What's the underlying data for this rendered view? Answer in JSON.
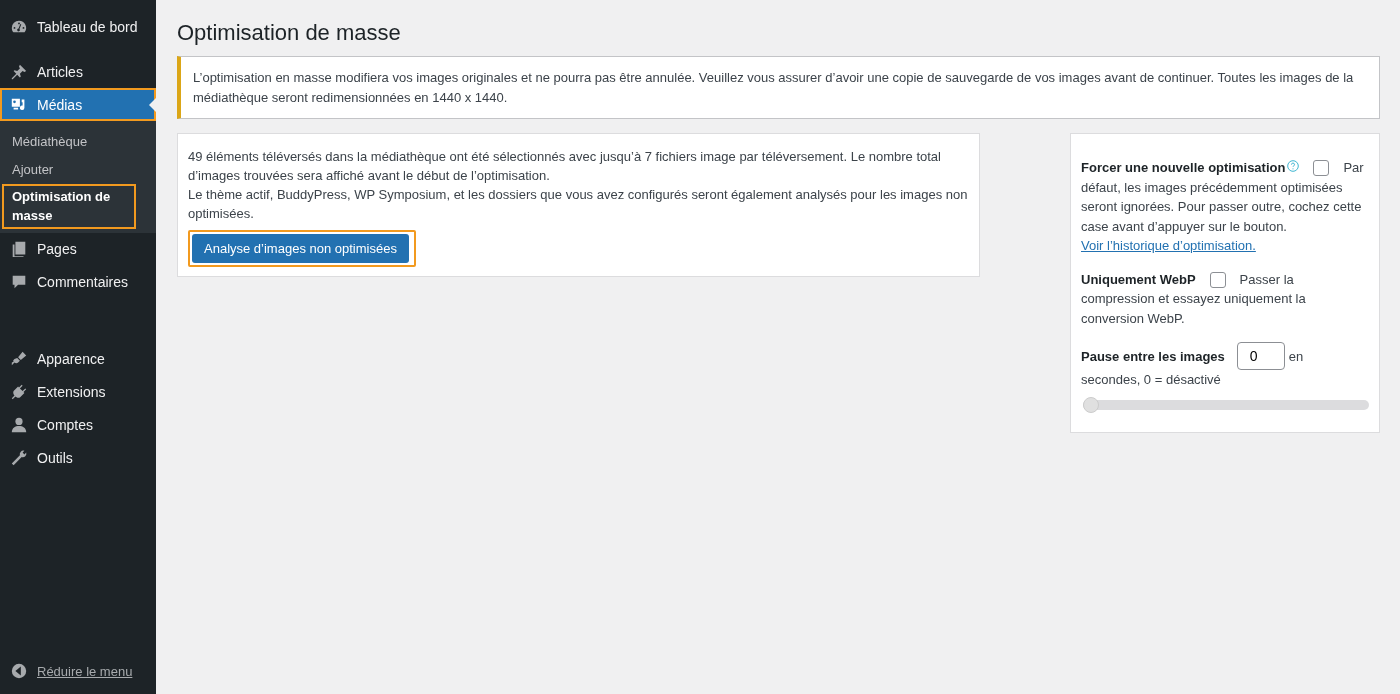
{
  "sidebar": {
    "groups": [
      [
        {
          "label": "Tableau de bord",
          "selected": false,
          "highlighted": false
        }
      ],
      [
        {
          "label": "Articles",
          "selected": false,
          "highlighted": false
        },
        {
          "label": "Médias",
          "selected": true,
          "highlighted": true,
          "children": [
            {
              "label": "Médiathèque",
              "selected": false,
              "highlighted": false
            },
            {
              "label": "Ajouter",
              "selected": false,
              "highlighted": false
            },
            {
              "label": "Optimisation de masse",
              "selected": true,
              "highlighted": true
            }
          ]
        },
        {
          "label": "Pages",
          "selected": false,
          "highlighted": false
        },
        {
          "label": "Commentaires",
          "selected": false,
          "highlighted": false
        }
      ],
      [
        {
          "label": "Apparence",
          "selected": false,
          "highlighted": false
        },
        {
          "label": "Extensions",
          "selected": false,
          "highlighted": false
        },
        {
          "label": "Comptes",
          "selected": false,
          "highlighted": false
        },
        {
          "label": "Outils",
          "selected": false,
          "highlighted": false
        }
      ]
    ],
    "collapse": "Réduire le menu"
  },
  "page_title": "Optimisation de masse",
  "notice": "L’optimisation en masse modifiera vos images originales et ne pourra pas être annulée. Veuillez vous assurer d’avoir une copie de sauvegarde de vos images avant de continuer. Toutes les images de la médiathèque seront redimensionnées en 1440 x 1440.",
  "scan_card": {
    "paragraphs": [
      "49 éléments téléversés dans la médiathèque ont été sélectionnés avec jusqu’à 7 fichiers image par téléversement. Le nombre total d’images trouvées sera affiché avant le début de l’optimisation.",
      "Le thème actif, BuddyPress, WP Symposium, et les dossiers que vous avez configurés seront également analysés pour les images non optimisées."
    ],
    "button": {
      "label": "Analyse d’images non optimisées",
      "highlighted": true
    }
  },
  "options": {
    "force": {
      "label": "Forcer une nouvelle optimisation",
      "checked": false,
      "description": [
        "Par",
        "défaut, les images précédemment optimisées seront ignorées. Pour passer outre, cochez cette case avant d’appuyer sur le bouton."
      ],
      "link": "Voir l’historique d’optimisation."
    },
    "webp": {
      "label": "Uniquement WebP",
      "checked": false,
      "description": [
        "Passer la",
        "compression et essayez uniquement la conversion WebP."
      ]
    },
    "pause": {
      "label": "Pause entre les images",
      "value": "0",
      "description": [
        "en",
        "secondes, 0 = désactivé"
      ],
      "level": 0
    }
  }
}
